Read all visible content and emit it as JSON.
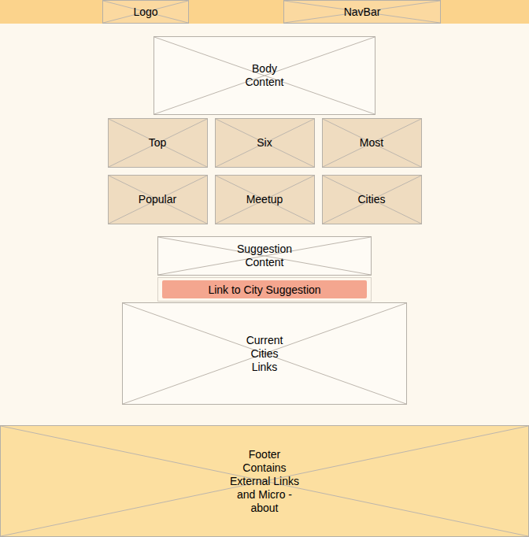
{
  "header": {
    "logo": {
      "label": "Logo"
    },
    "navbar": {
      "label": "NavBar"
    }
  },
  "body": {
    "label": "Body\nContent"
  },
  "tiles": [
    {
      "label": "Top"
    },
    {
      "label": "Six"
    },
    {
      "label": "Most"
    },
    {
      "label": "Popular"
    },
    {
      "label": "Meetup"
    },
    {
      "label": "Cities"
    }
  ],
  "suggestion": {
    "label": "Suggestion\nContent"
  },
  "suggestion_link": {
    "label": "Link to City Suggestion"
  },
  "cities": {
    "label": "Current\nCities\nLinks"
  },
  "footer": {
    "label": "Footer\nContains\nExternal Links\nand Micro -\nabout"
  }
}
